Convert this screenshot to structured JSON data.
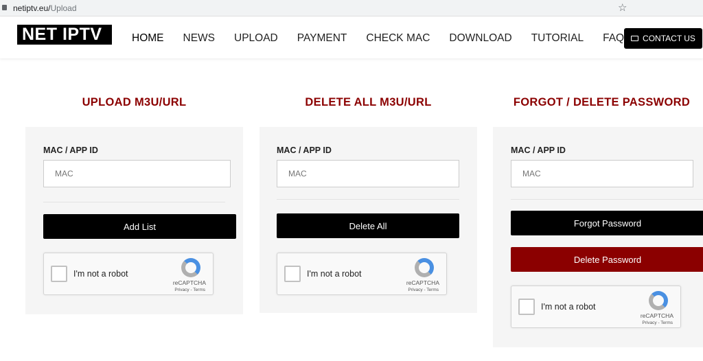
{
  "browser": {
    "url_host": "netiptv.eu/",
    "url_path": "Upload"
  },
  "nav": {
    "logo": "NET IPTV",
    "items": [
      "HOME",
      "NEWS",
      "UPLOAD",
      "PAYMENT",
      "CHECK MAC",
      "DOWNLOAD",
      "TUTORIAL",
      "FAQ'S"
    ],
    "contact": "CONTACT US"
  },
  "sections": [
    {
      "title": "UPLOAD M3U/URL",
      "label": "MAC / APP ID",
      "placeholder": "MAC",
      "buttons": [
        "Add List"
      ]
    },
    {
      "title": "DELETE ALL M3U/URL",
      "label": "MAC / APP ID",
      "placeholder": "MAC",
      "buttons": [
        "Delete All"
      ]
    },
    {
      "title": "FORGOT / DELETE PASSWORD",
      "label": "MAC / APP ID",
      "placeholder": "MAC",
      "buttons": [
        "Forgot Password",
        "Delete Password"
      ]
    }
  ],
  "captcha": {
    "text": "I'm not a robot",
    "brand": "reCAPTCHA",
    "terms": "Privacy - Terms"
  },
  "colors": {
    "accent": "#8b0000",
    "button": "#000000"
  }
}
